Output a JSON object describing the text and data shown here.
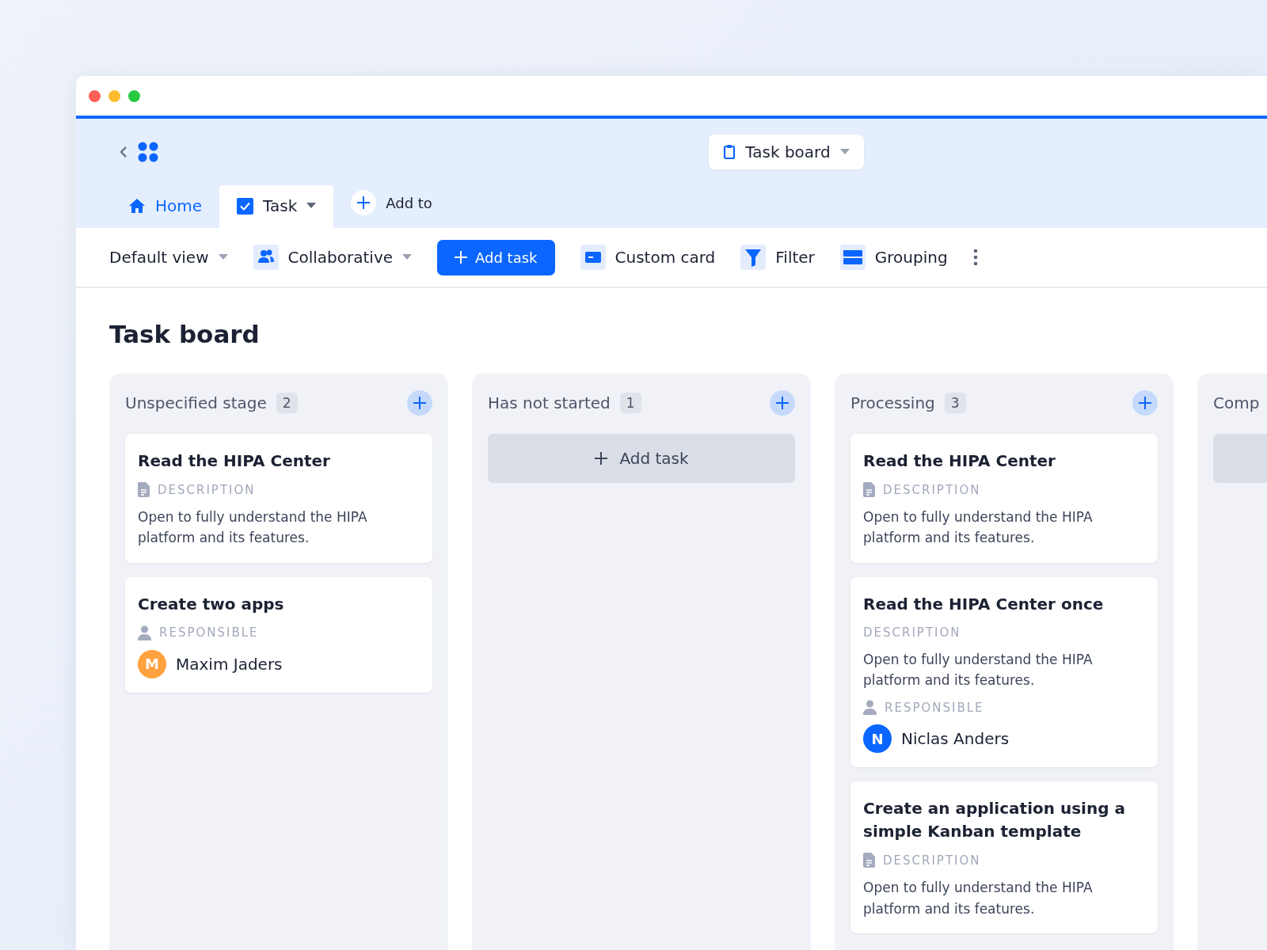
{
  "header": {
    "board_selector": "Task board"
  },
  "tabs": [
    {
      "kind": "home",
      "label": "Home",
      "selected": false
    },
    {
      "kind": "task",
      "label": "Task",
      "selected": true
    }
  ],
  "add_tab": "Add to",
  "toolbar": {
    "view": "Default view",
    "mode": "Collaborative",
    "add_task": "Add task",
    "actions": [
      {
        "kind": "card",
        "label": "Custom card"
      },
      {
        "kind": "filter",
        "label": "Filter"
      },
      {
        "kind": "grouping",
        "label": "Grouping"
      }
    ]
  },
  "page_title": "Task board",
  "columns": [
    {
      "title": "Unspecified stage",
      "count": "2",
      "cards": [
        {
          "title": "Read the HIPA Center",
          "fields": [
            {
              "kind": "description",
              "label": "DESCRIPTION",
              "icon": true,
              "text": "Open to fully understand the HIPA platform and its features."
            }
          ]
        },
        {
          "title": "Create two apps",
          "fields": [
            {
              "kind": "responsible",
              "label": "RESPONSIBLE",
              "icon": true,
              "initial": "M",
              "name": "Maxim Jaders",
              "color": "#ffa23e"
            }
          ]
        }
      ]
    },
    {
      "title": "Has not started",
      "count": "1",
      "add_task": "Add task"
    },
    {
      "title": "Processing",
      "count": "3",
      "cards": [
        {
          "title": "Read the HIPA Center",
          "fields": [
            {
              "kind": "description",
              "label": "DESCRIPTION",
              "icon": true,
              "text": "Open to fully understand the HIPA platform and its features."
            }
          ]
        },
        {
          "title": "Read the HIPA Center once",
          "fields": [
            {
              "kind": "description",
              "label": "DESCRIPTION",
              "icon": false,
              "text": "Open to fully understand the HIPA platform and its features."
            },
            {
              "kind": "responsible",
              "label": "RESPONSIBLE",
              "icon": true,
              "initial": "N",
              "name": "Niclas Anders",
              "color": "#0a66ff"
            }
          ]
        },
        {
          "title": "Create an application using a simple Kanban template",
          "fields": [
            {
              "kind": "description",
              "label": "DESCRIPTION",
              "icon": true,
              "text": "Open to fully understand the HIPA platform and its features."
            }
          ]
        }
      ]
    },
    {
      "title": "Comp",
      "add_placeholder": true
    }
  ]
}
